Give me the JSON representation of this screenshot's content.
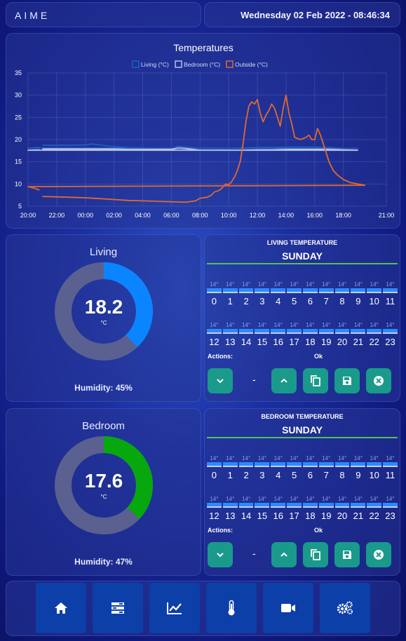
{
  "header": {
    "app_name": "AIME",
    "datetime": "Wednesday 02 Feb 2022 - 08:46:34"
  },
  "chart_data": {
    "type": "line",
    "title": "Temperatures",
    "x": [
      "20:00",
      "22:00",
      "00:00",
      "02:00",
      "04:00",
      "06:00",
      "08:00",
      "10:00",
      "12:00",
      "14:00",
      "16:00",
      "18:00",
      "21:00"
    ],
    "ylim": [
      5,
      35
    ],
    "yticks": [
      5,
      10,
      15,
      20,
      25,
      30,
      35
    ],
    "legend_position": "top-center",
    "grid": true,
    "series": [
      {
        "name": "Living (°C)",
        "color": "#1f5fc0",
        "points": [
          [
            21.0,
            18.7
          ],
          [
            22.0,
            18.7
          ],
          [
            23.0,
            18.7
          ],
          [
            0.0,
            18.8
          ],
          [
            0.5,
            19.0
          ],
          [
            1.0,
            18.8
          ],
          [
            2.0,
            18.4
          ],
          [
            3.0,
            18.2
          ],
          [
            4.0,
            18.1
          ],
          [
            5.0,
            18.0
          ],
          [
            6.0,
            18.0
          ],
          [
            6.5,
            18.5
          ],
          [
            7.0,
            18.3
          ],
          [
            8.0,
            18.0
          ],
          [
            9.0,
            18.0
          ],
          [
            10.0,
            18.0
          ],
          [
            11.0,
            18.1
          ],
          [
            12.0,
            18.2
          ],
          [
            13.0,
            18.2
          ],
          [
            14.0,
            18.3
          ],
          [
            15.0,
            18.3
          ],
          [
            16.0,
            18.3
          ],
          [
            17.0,
            18.2
          ],
          [
            18.0,
            18.0
          ],
          [
            19.0,
            18.0
          ],
          [
            20.0,
            18.1
          ],
          [
            20.8,
            18.2
          ]
        ]
      },
      {
        "name": "Bedroom (°C)",
        "color": "#b8c0e0",
        "points": [
          [
            21.0,
            17.9
          ],
          [
            22.0,
            17.9
          ],
          [
            23.0,
            17.9
          ],
          [
            0.0,
            17.9
          ],
          [
            1.0,
            17.9
          ],
          [
            2.0,
            17.9
          ],
          [
            3.0,
            17.8
          ],
          [
            4.0,
            17.8
          ],
          [
            5.0,
            17.8
          ],
          [
            6.0,
            17.8
          ],
          [
            6.5,
            18.1
          ],
          [
            7.0,
            18.0
          ],
          [
            8.0,
            17.6
          ],
          [
            9.0,
            17.6
          ],
          [
            10.0,
            17.6
          ],
          [
            11.0,
            17.6
          ],
          [
            12.0,
            17.7
          ],
          [
            13.0,
            17.7
          ],
          [
            14.0,
            17.8
          ],
          [
            15.0,
            17.8
          ],
          [
            16.0,
            17.8
          ],
          [
            17.0,
            17.8
          ],
          [
            18.0,
            17.7
          ],
          [
            19.0,
            17.6
          ],
          [
            20.0,
            17.6
          ],
          [
            20.8,
            17.7
          ]
        ]
      },
      {
        "name": "Outside (°C)",
        "color": "#e06a2c",
        "points": [
          [
            21.0,
            7.2
          ],
          [
            22.0,
            7.1
          ],
          [
            23.0,
            7.0
          ],
          [
            0.0,
            6.9
          ],
          [
            1.0,
            6.7
          ],
          [
            2.0,
            6.5
          ],
          [
            3.0,
            6.3
          ],
          [
            4.0,
            6.2
          ],
          [
            5.0,
            6.1
          ],
          [
            6.0,
            6.0
          ],
          [
            7.0,
            5.9
          ],
          [
            7.7,
            6.2
          ],
          [
            8.0,
            6.8
          ],
          [
            8.5,
            7.0
          ],
          [
            8.8,
            7.5
          ],
          [
            9.0,
            8.2
          ],
          [
            9.3,
            8.5
          ],
          [
            9.5,
            9.0
          ],
          [
            9.8,
            10.0
          ],
          [
            10.0,
            9.8
          ],
          [
            10.2,
            10.5
          ],
          [
            10.4,
            11.5
          ],
          [
            10.6,
            13.0
          ],
          [
            10.8,
            15.0
          ],
          [
            11.0,
            19.0
          ],
          [
            11.2,
            24.0
          ],
          [
            11.4,
            27.5
          ],
          [
            11.6,
            28.5
          ],
          [
            11.8,
            28.0
          ],
          [
            12.0,
            29.0
          ],
          [
            12.2,
            26.0
          ],
          [
            12.4,
            24.0
          ],
          [
            12.6,
            25.5
          ],
          [
            12.8,
            26.5
          ],
          [
            13.0,
            28.0
          ],
          [
            13.2,
            27.0
          ],
          [
            13.4,
            25.0
          ],
          [
            13.6,
            23.0
          ],
          [
            13.8,
            27.0
          ],
          [
            14.0,
            30.0
          ],
          [
            14.2,
            26.0
          ],
          [
            14.4,
            23.5
          ],
          [
            14.6,
            20.5
          ],
          [
            15.0,
            20.0
          ],
          [
            15.4,
            20.5
          ],
          [
            15.6,
            21.0
          ],
          [
            15.8,
            20.0
          ],
          [
            16.0,
            20.0
          ],
          [
            16.2,
            22.5
          ],
          [
            16.4,
            21.0
          ],
          [
            16.6,
            19.0
          ],
          [
            16.8,
            17.0
          ],
          [
            17.0,
            15.0
          ],
          [
            17.3,
            13.0
          ],
          [
            17.6,
            12.0
          ],
          [
            18.0,
            11.0
          ],
          [
            18.5,
            10.3
          ],
          [
            19.0,
            10.0
          ],
          [
            19.5,
            9.7
          ],
          [
            20.0,
            9.4
          ],
          [
            20.5,
            9.0
          ],
          [
            20.8,
            8.6
          ]
        ]
      }
    ]
  },
  "living": {
    "title": "Living",
    "temperature": "18.2",
    "unit": "°C",
    "humidity": "Humidity: 45%",
    "gauge_fraction": 0.38,
    "gauge_color": "#0a85ff"
  },
  "bedroom": {
    "title": "Bedroom",
    "temperature": "17.6",
    "unit": "°C",
    "humidity": "Humidity: 47%",
    "gauge_fraction": 0.37,
    "gauge_color": "#06a80e"
  },
  "living_schedule": {
    "title": "LIVING TEMPERATURE",
    "day": "SUNDAY",
    "slot_temp": "14°",
    "hours_am": [
      "0",
      "1",
      "2",
      "3",
      "4",
      "5",
      "6",
      "7",
      "8",
      "9",
      "10",
      "11"
    ],
    "hours_pm": [
      "12",
      "13",
      "14",
      "15",
      "16",
      "17",
      "18",
      "19",
      "20",
      "21",
      "22",
      "23"
    ],
    "actions_label": "Actions:",
    "status": "Ok",
    "dash": "-"
  },
  "bedroom_schedule": {
    "title": "BEDROOM TEMPERATURE",
    "day": "SUNDAY",
    "slot_temp": "14°",
    "hours_am": [
      "0",
      "1",
      "2",
      "3",
      "4",
      "5",
      "6",
      "7",
      "8",
      "9",
      "10",
      "11"
    ],
    "hours_pm": [
      "12",
      "13",
      "14",
      "15",
      "16",
      "17",
      "18",
      "19",
      "20",
      "21",
      "22",
      "23"
    ],
    "actions_label": "Actions:",
    "status": "Ok",
    "dash": "-"
  },
  "nav": {
    "items": [
      "home-icon",
      "list-icon",
      "chart-line-icon",
      "thermometer-icon",
      "video-camera-icon",
      "cogs-icon"
    ]
  },
  "colors": {
    "accent_green": "#4fc25a",
    "button_teal": "#1a9a8a",
    "nav_button": "#0c3fa8",
    "gauge_track": "#5a6190"
  }
}
